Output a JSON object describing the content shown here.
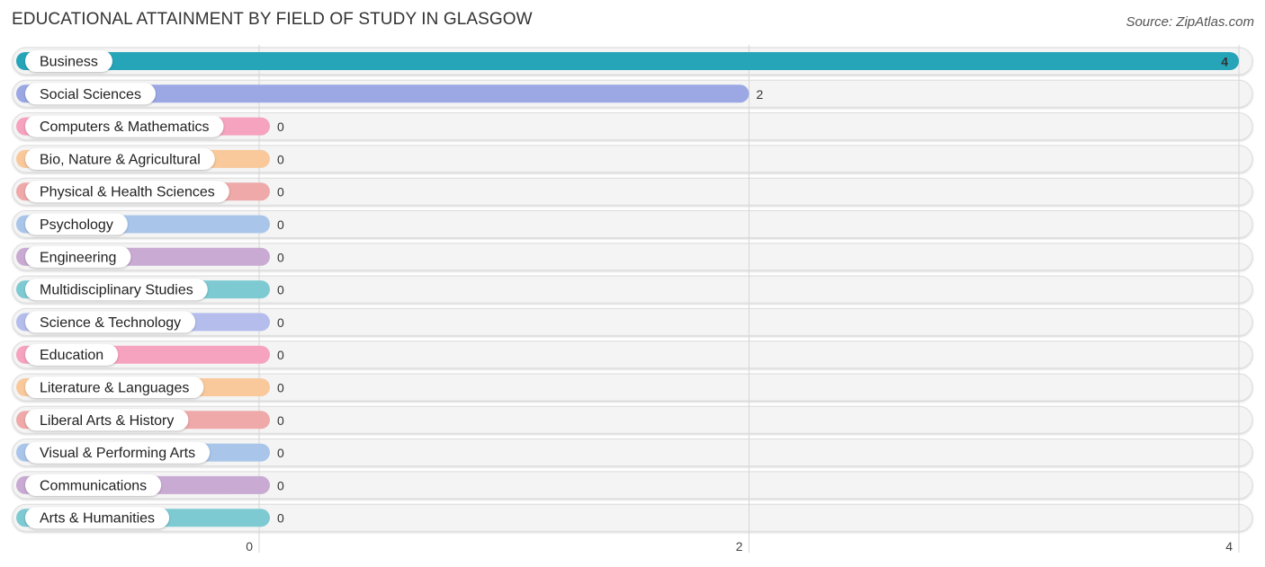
{
  "chart_data": {
    "type": "bar",
    "orientation": "horizontal",
    "title": "EDUCATIONAL ATTAINMENT BY FIELD OF STUDY IN GLASGOW",
    "source": "Source: ZipAtlas.com",
    "xlabel": "",
    "ylabel": "",
    "xlim": [
      0,
      4
    ],
    "xticks": [
      0,
      2,
      4
    ],
    "grid": true,
    "categories": [
      "Business",
      "Social Sciences",
      "Computers & Mathematics",
      "Bio, Nature & Agricultural",
      "Physical & Health Sciences",
      "Psychology",
      "Engineering",
      "Multidisciplinary Studies",
      "Science & Technology",
      "Education",
      "Literature & Languages",
      "Liberal Arts & History",
      "Visual & Performing Arts",
      "Communications",
      "Arts & Humanities"
    ],
    "values": [
      4,
      2,
      0,
      0,
      0,
      0,
      0,
      0,
      0,
      0,
      0,
      0,
      0,
      0,
      0
    ],
    "colors": [
      "#26a5b8",
      "#9ba8e4",
      "#f5a3bf",
      "#f9c99b",
      "#efa9a9",
      "#a9c6ea",
      "#c9aad3",
      "#7ecad2",
      "#b5bdec",
      "#f5a3bf",
      "#f9c99b",
      "#efa9a9",
      "#a9c6ea",
      "#c9aad3",
      "#7ecad2"
    ]
  }
}
